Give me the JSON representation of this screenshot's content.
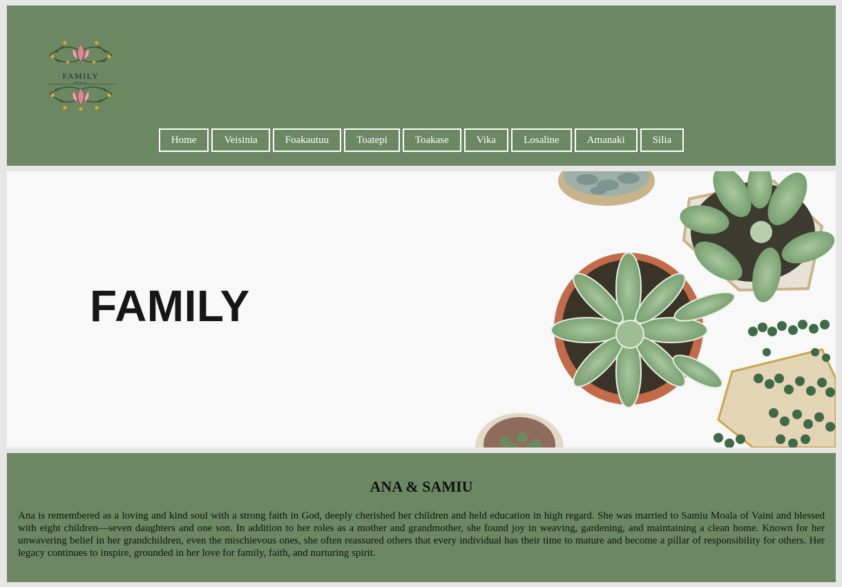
{
  "logo": {
    "text": "FAMILY",
    "subtext": "MOALA",
    "icon": "floral-wreath-icon"
  },
  "nav": {
    "items": [
      "Home",
      "Veisinia",
      "Foakautuu",
      "Toatepi",
      "Toakase",
      "Vika",
      "Losaline",
      "Amanaki",
      "Silia"
    ]
  },
  "hero": {
    "title": "FAMILY",
    "image": "succulent-plants-photo"
  },
  "bio": {
    "title": "ANA & SAMIU",
    "text": "Ana is remembered as a loving and kind soul with a strong faith in God, deeply cherished her children and held education in high regard. She was married to Samiu Moala of Vaini and blessed with eight children—seven daughters and one son. In addition to her roles as a mother and grandmother, she found joy in weaving, gardening, and maintaining a clean home. Known for her unwavering belief in her grandchildren, even the mischievous ones, she often reassured others that every individual has their time to mature and become a pillar of responsibility for others. Her legacy continues to inspire, grounded in her love for family, faith, and nurturing spirit."
  },
  "colors": {
    "header_bg": "#6b8863",
    "page_bg": "#e6e6e6",
    "hero_bg": "#f7f8f7",
    "accent_pink": "#d88a93",
    "accent_yellow": "#e0a82a"
  }
}
